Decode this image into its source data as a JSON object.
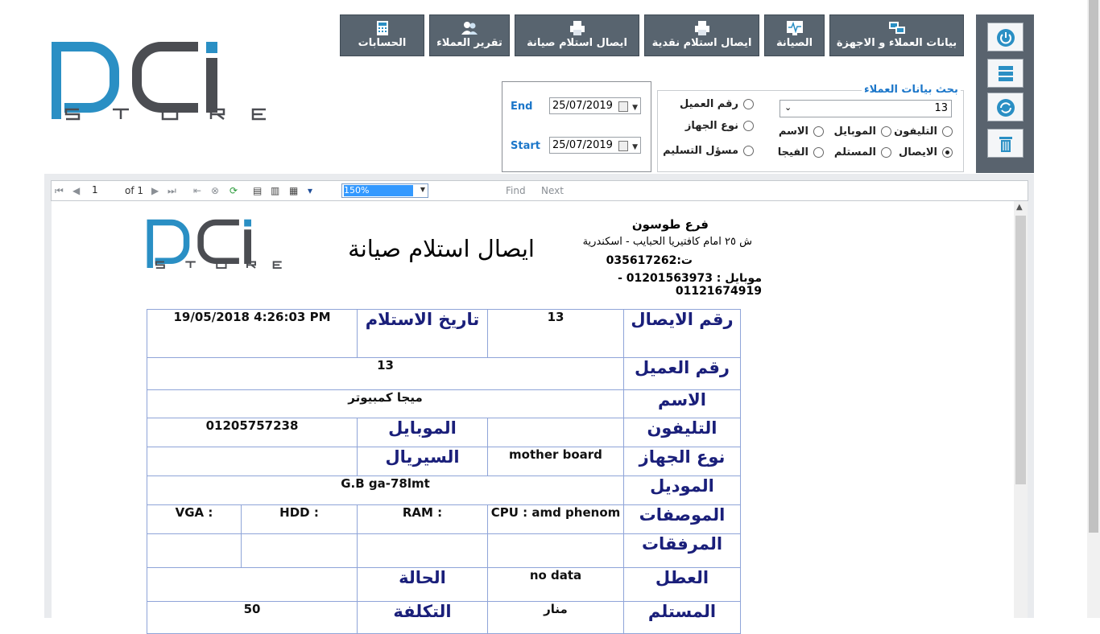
{
  "brand": {
    "logo_main": "DCi",
    "logo_sub": "STORE"
  },
  "menu": [
    {
      "label": "بيانات العملاء و الاجهزة",
      "icon": "computers-icon"
    },
    {
      "label": "الصيانة",
      "icon": "monitor-pulse-icon"
    },
    {
      "label": "ايصال استلام نقدية",
      "icon": "printer-icon"
    },
    {
      "label": "ايصال استلام صيانة",
      "icon": "printer-icon"
    },
    {
      "label": "تقرير العملاء",
      "icon": "users-icon"
    },
    {
      "label": "الحسابات",
      "icon": "calculator-icon"
    }
  ],
  "side_buttons": [
    "power-icon",
    "database-icon",
    "refresh-icon",
    "trash-icon"
  ],
  "dates": {
    "end_label": "End",
    "start_label": "Start",
    "end_value": "25/07/2019",
    "start_value": "25/07/2019"
  },
  "options": {
    "customer_no": "رقم العميل",
    "device_type": "نوع الجهاز",
    "delivery": "مسؤل التسليم"
  },
  "search": {
    "legend": "بحث بيانات العملاء",
    "value": "13",
    "radios": {
      "phone": "التليفون",
      "mobile": "الموبايل",
      "name": "الاسم",
      "receipt": "الايصال",
      "receiver": "المستلم",
      "vga": "الفيجا"
    },
    "selected": "receipt"
  },
  "toolbar": {
    "page": "1",
    "of_label": "of 1",
    "zoom": "150%",
    "find": "Find",
    "next": "Next"
  },
  "report": {
    "branch": "فرع طوسون",
    "address": "ش ٢٥ امام كافتيريا الحبايب  - اسكندرية",
    "tel": "ت:035617262",
    "mobile": "موبايل : 01201563973 - 01121674919",
    "title": "ايصال استلام صيانة",
    "labels": {
      "receipt_no": "رقم الايصال",
      "receive_date": "تاريخ الاستلام",
      "customer_no": "رقم العميل",
      "name": "الاسم",
      "phone": "التليفون",
      "mobile": "الموبايل",
      "device_type": "نوع الجهاز",
      "serial": "السيريال",
      "model": "الموديل",
      "specs": "الموصفات",
      "attachments": "المرفقات",
      "fault": "العطل",
      "status": "الحالة",
      "receiver": "المستلم",
      "cost": "التكلفة"
    },
    "values": {
      "receipt_no": "13",
      "receive_date": "19/05/2018 4:26:03 PM",
      "customer_no": "13",
      "name": "ميجا كمبيوتر",
      "mobile": "01205757238",
      "device_type": "mother board",
      "model": "G.B ga-78lmt",
      "cpu": "CPU : amd phenom",
      "ram": "RAM :",
      "hdd": "HDD :",
      "vga": "VGA :",
      "fault": "no data",
      "receiver": "منار",
      "cost": "50"
    }
  },
  "colors": {
    "brand_blue": "#2a8fc4",
    "brand_gray": "#4b4d52",
    "menu_bg": "#58646f",
    "label_navy": "#1a1f7a",
    "accent_blue": "#1b76c9"
  }
}
